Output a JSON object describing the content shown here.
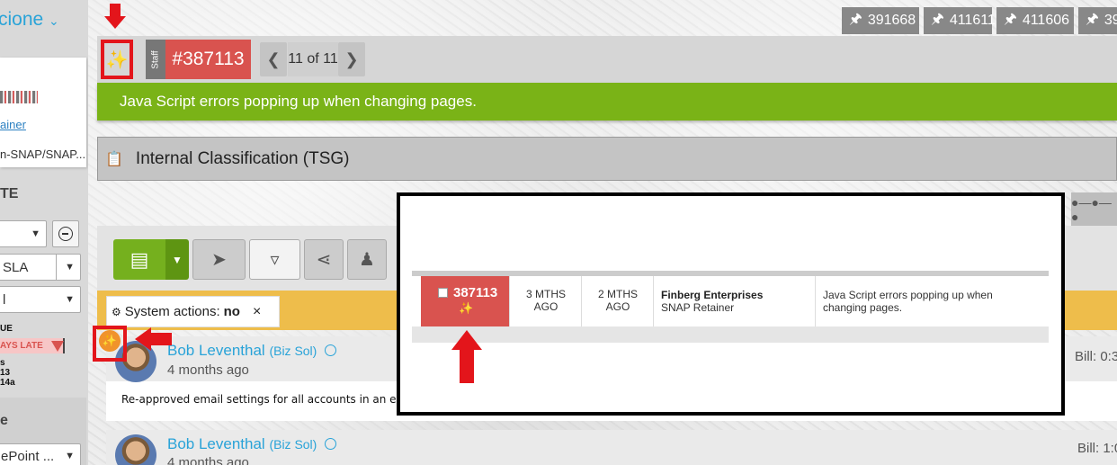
{
  "sidebar": {
    "title": "cione",
    "link_text": "ainer",
    "plan_text": "n-SNAP/SNAP...",
    "section_heading": "TE",
    "select_sla": "SLA",
    "select_l": "l",
    "label_ue": "UE",
    "late_label": "AYS LATE",
    "line_s": "s",
    "line_13": "13",
    "line_14a": "14a",
    "bottom_heading": "e",
    "bottom_select": "ePoint ..."
  },
  "pinned_tabs": [
    "391668",
    "411611",
    "411606",
    "39"
  ],
  "ticket": {
    "staff_label": "Staff",
    "id": "#387113",
    "position": "11 of 11",
    "subject": "Java Script errors popping up when changing pages.",
    "classification": "Internal Classification (TSG)"
  },
  "filter": {
    "label": "System actions:",
    "value": "no",
    "close": "×"
  },
  "entries": [
    {
      "author": "Bob Leventhal",
      "org": "(Biz Sol)",
      "time_ago": "4 months ago",
      "bill": "Bill: 0:3",
      "body": "Re-approved email settings for all accounts in an e"
    },
    {
      "author": "Bob Leventhal",
      "org": "(Biz Sol)",
      "time_ago": "4 months ago",
      "bill": "Bill: 1:0",
      "body": ""
    }
  ],
  "popup_row": {
    "id": "387113",
    "created": "3 MTHS AGO",
    "updated": "2 MTHS AGO",
    "company": "Finberg Enterprises",
    "plan": "SNAP Retainer",
    "subject": "Java Script errors popping up when changing pages."
  },
  "colors": {
    "accent_blue": "#29a3d8",
    "ticket_red": "#d9534f",
    "subject_green": "#7ab317",
    "filter_yellow": "#eebd4b",
    "annotation_red": "#e3151b"
  }
}
